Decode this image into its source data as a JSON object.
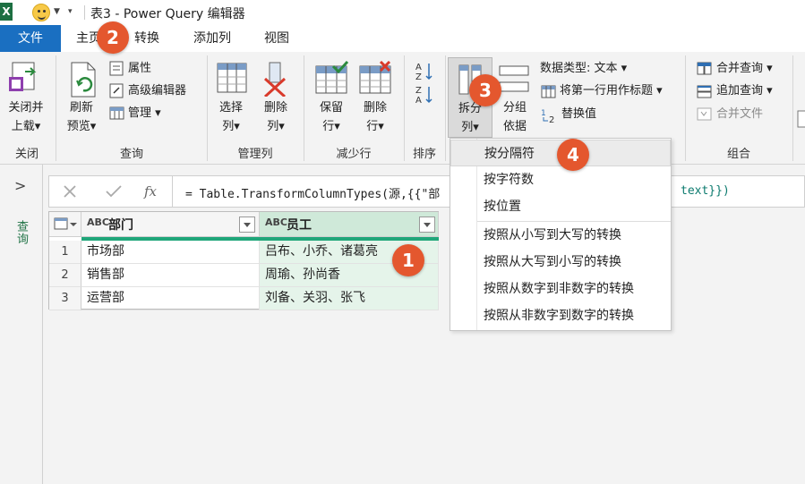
{
  "titlebar": {
    "app_icon": "X",
    "title": "表3 - Power Query 编辑器"
  },
  "tabs": {
    "file": "文件",
    "home": "主页",
    "transform": "转换",
    "add_column": "添加列",
    "view": "视图"
  },
  "ribbon": {
    "close_group": {
      "label": "关闭",
      "close_load_line1": "关闭并",
      "close_load_line2": "上载▾"
    },
    "query_group": {
      "label": "查询",
      "refresh_line1": "刷新",
      "refresh_line2": "预览▾",
      "properties": "属性",
      "advanced_editor": "高级编辑器",
      "manage": "管理 ▾"
    },
    "manage_cols_group": {
      "label": "管理列",
      "choose_line1": "选择",
      "choose_line2": "列▾",
      "remove_line1": "删除",
      "remove_line2": "列▾"
    },
    "reduce_rows_group": {
      "label": "减少行",
      "keep_line1": "保留",
      "keep_line2": "行▾",
      "remove_line1": "删除",
      "remove_line2": "行▾"
    },
    "sort_group": {
      "label": "排序"
    },
    "transform_group": {
      "split_line1": "拆分",
      "split_line2": "列▾",
      "group_line1": "分组",
      "group_line2": "依据",
      "data_type": "数据类型: 文本 ▾",
      "first_row_header": "将第一行用作标题 ▾",
      "replace_values": "替换值"
    },
    "combine_group": {
      "label": "组合",
      "merge_queries": "合并查询 ▾",
      "append_queries": "追加查询 ▾",
      "combine_files": "合并文件"
    }
  },
  "leftpanel": {
    "label": "查询"
  },
  "formula": {
    "text_start": "= Table.TransformColumnTypes(源,{{\"部",
    "text_end": "text}})"
  },
  "grid": {
    "columns": [
      {
        "type": "ABC",
        "name": "部门"
      },
      {
        "type": "ABC",
        "name": "员工"
      }
    ],
    "rows": [
      {
        "n": "1",
        "dept": "市场部",
        "staff": "吕布、小乔、诸葛亮"
      },
      {
        "n": "2",
        "dept": "销售部",
        "staff": "周瑜、孙尚香"
      },
      {
        "n": "3",
        "dept": "运营部",
        "staff": "刘备、关羽、张飞"
      }
    ]
  },
  "split_menu": {
    "items": [
      "按分隔符",
      "按字符数",
      "按位置",
      "按照从小写到大写的转换",
      "按照从大写到小写的转换",
      "按照从数字到非数字的转换",
      "按照从非数字到数字的转换"
    ]
  },
  "badges": [
    "1",
    "2",
    "3",
    "4"
  ],
  "colors": {
    "file_tab": "#1a6fc1",
    "selected_column": "#cfe9d9",
    "badge": "#e4572e",
    "quality_bar": "#1fa67a"
  }
}
